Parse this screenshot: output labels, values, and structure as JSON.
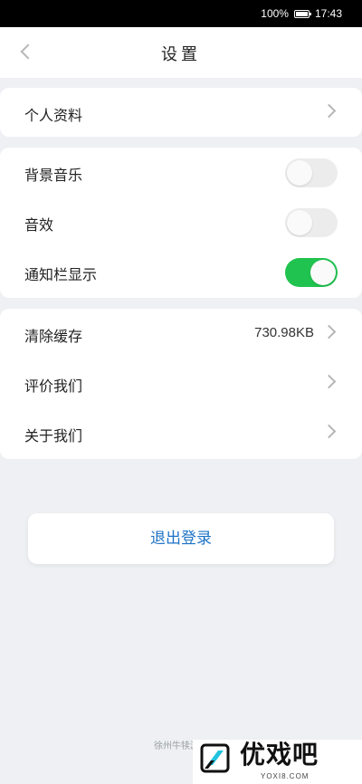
{
  "status_bar": {
    "battery_text": "100%",
    "time": "17:43"
  },
  "nav": {
    "title": "设置",
    "back_icon": "chevron-left-icon"
  },
  "sections": {
    "profile": {
      "label": "个人资料"
    },
    "settings": [
      {
        "label": "背景音乐",
        "enabled": false
      },
      {
        "label": "音效",
        "enabled": false
      },
      {
        "label": "通知栏显示",
        "enabled": true
      }
    ],
    "others": [
      {
        "label": "清除缓存",
        "value": "730.98KB"
      },
      {
        "label": "评价我们"
      },
      {
        "label": "关于我们"
      }
    ]
  },
  "logout": {
    "label": "退出登录"
  },
  "footer": {
    "text": "徐州牛犊游戏"
  },
  "watermark": {
    "brand": "优戏吧",
    "url": "YOXI8.COM"
  },
  "colors": {
    "toggle_on": "#20c34f",
    "toggle_off": "#ececec",
    "logout_text": "#1e73c6",
    "background": "#eef0f3"
  }
}
